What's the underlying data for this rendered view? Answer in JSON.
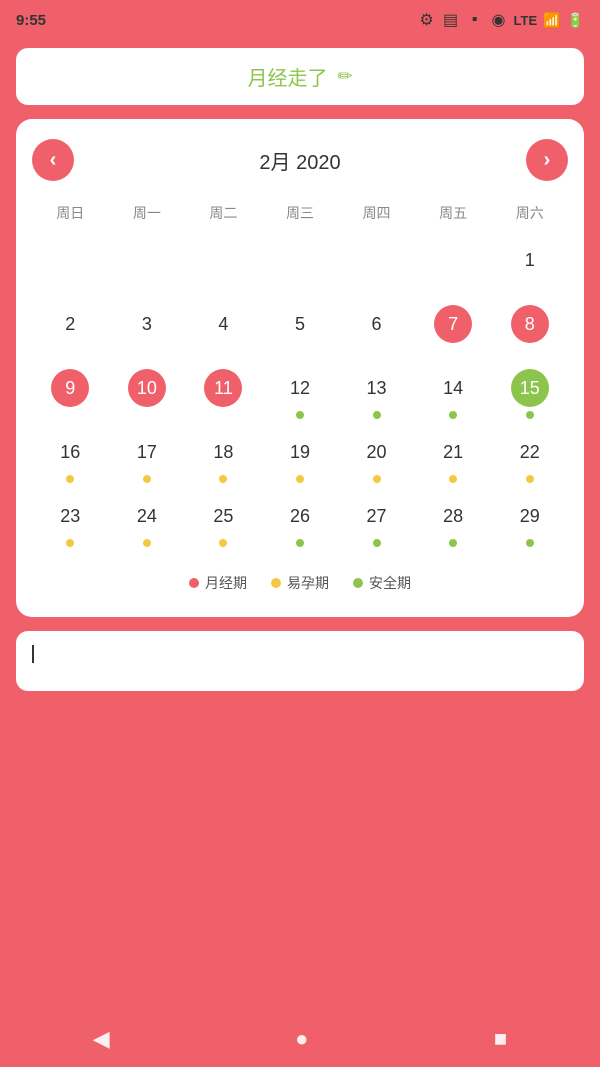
{
  "statusBar": {
    "time": "9:55",
    "network": "LTE"
  },
  "title": {
    "text": "月经走了",
    "editIcon": "✏"
  },
  "calendar": {
    "monthLabel": "2月 2020",
    "weekdays": [
      "周日",
      "周一",
      "周二",
      "周三",
      "周四",
      "周五",
      "周六"
    ],
    "prevBtn": "‹",
    "nextBtn": "›",
    "days": [
      {
        "day": null,
        "type": "empty"
      },
      {
        "day": null,
        "type": "empty"
      },
      {
        "day": null,
        "type": "empty"
      },
      {
        "day": null,
        "type": "empty"
      },
      {
        "day": null,
        "type": "empty"
      },
      {
        "day": null,
        "type": "empty"
      },
      {
        "day": "1",
        "type": "normal",
        "dot": null
      },
      {
        "day": "2",
        "type": "normal",
        "dot": null
      },
      {
        "day": "3",
        "type": "normal",
        "dot": null
      },
      {
        "day": "4",
        "type": "normal",
        "dot": null
      },
      {
        "day": "5",
        "type": "normal",
        "dot": null
      },
      {
        "day": "6",
        "type": "normal",
        "dot": null
      },
      {
        "day": "7",
        "type": "period",
        "dot": null
      },
      {
        "day": "8",
        "type": "period",
        "dot": null
      },
      {
        "day": "9",
        "type": "period",
        "dot": null
      },
      {
        "day": "10",
        "type": "period",
        "dot": null
      },
      {
        "day": "11",
        "type": "period",
        "dot": null
      },
      {
        "day": "12",
        "type": "normal",
        "dot": "safe"
      },
      {
        "day": "13",
        "type": "normal",
        "dot": "safe"
      },
      {
        "day": "14",
        "type": "normal",
        "dot": "safe"
      },
      {
        "day": "15",
        "type": "today",
        "dot": "safe"
      },
      {
        "day": "16",
        "type": "normal",
        "dot": "fertile"
      },
      {
        "day": "17",
        "type": "normal",
        "dot": "fertile"
      },
      {
        "day": "18",
        "type": "normal",
        "dot": "fertile"
      },
      {
        "day": "19",
        "type": "normal",
        "dot": "fertile"
      },
      {
        "day": "20",
        "type": "normal",
        "dot": "fertile"
      },
      {
        "day": "21",
        "type": "normal",
        "dot": "fertile"
      },
      {
        "day": "22",
        "type": "normal",
        "dot": "fertile"
      },
      {
        "day": "23",
        "type": "normal",
        "dot": "fertile"
      },
      {
        "day": "24",
        "type": "normal",
        "dot": "fertile"
      },
      {
        "day": "25",
        "type": "normal",
        "dot": "fertile"
      },
      {
        "day": "26",
        "type": "normal",
        "dot": "safe"
      },
      {
        "day": "27",
        "type": "normal",
        "dot": "safe"
      },
      {
        "day": "28",
        "type": "normal",
        "dot": "safe"
      },
      {
        "day": "29",
        "type": "normal",
        "dot": "safe"
      }
    ]
  },
  "legend": [
    {
      "label": "月经期",
      "dotClass": "dot-period"
    },
    {
      "label": "易孕期",
      "dotClass": "dot-fertile"
    },
    {
      "label": "安全期",
      "dotClass": "dot-safe"
    }
  ],
  "bottomNav": {
    "back": "◀",
    "home": "●",
    "recent": "■"
  }
}
